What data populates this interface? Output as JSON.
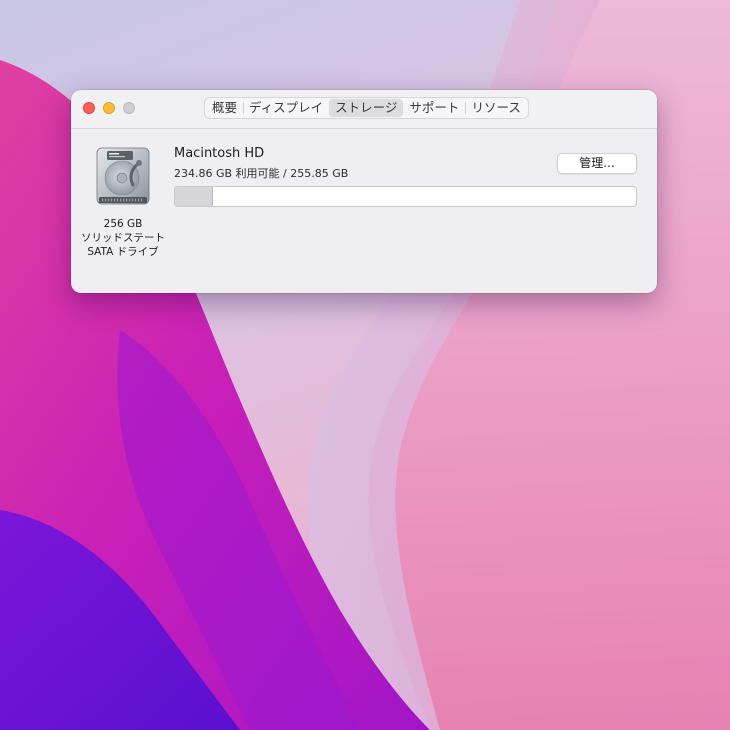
{
  "window": {
    "tabs": [
      {
        "label": "概要",
        "active": false
      },
      {
        "label": "ディスプレイ",
        "active": false
      },
      {
        "label": "ストレージ",
        "active": true
      },
      {
        "label": "サポート",
        "active": false
      },
      {
        "label": "リソース",
        "active": false
      }
    ]
  },
  "disk": {
    "icon": "hard-drive-icon",
    "size_label": "256 GB",
    "type_label": "ソリッドステート",
    "interface_label": "SATA ドライブ",
    "name": "Macintosh HD",
    "capacity_text": "234.86 GB 利用可能 / 255.85 GB",
    "available_gb": 234.86,
    "total_gb": 255.85,
    "manage_button_label": "管理..."
  },
  "colors": {
    "close": "#fe5f57",
    "minimize": "#febc2e",
    "zoom_inactive": "#cfcdd1",
    "window_bg": "#efeef0",
    "wallpaper_magenta": "#c81fb8",
    "wallpaper_purple": "#6a12d6"
  }
}
